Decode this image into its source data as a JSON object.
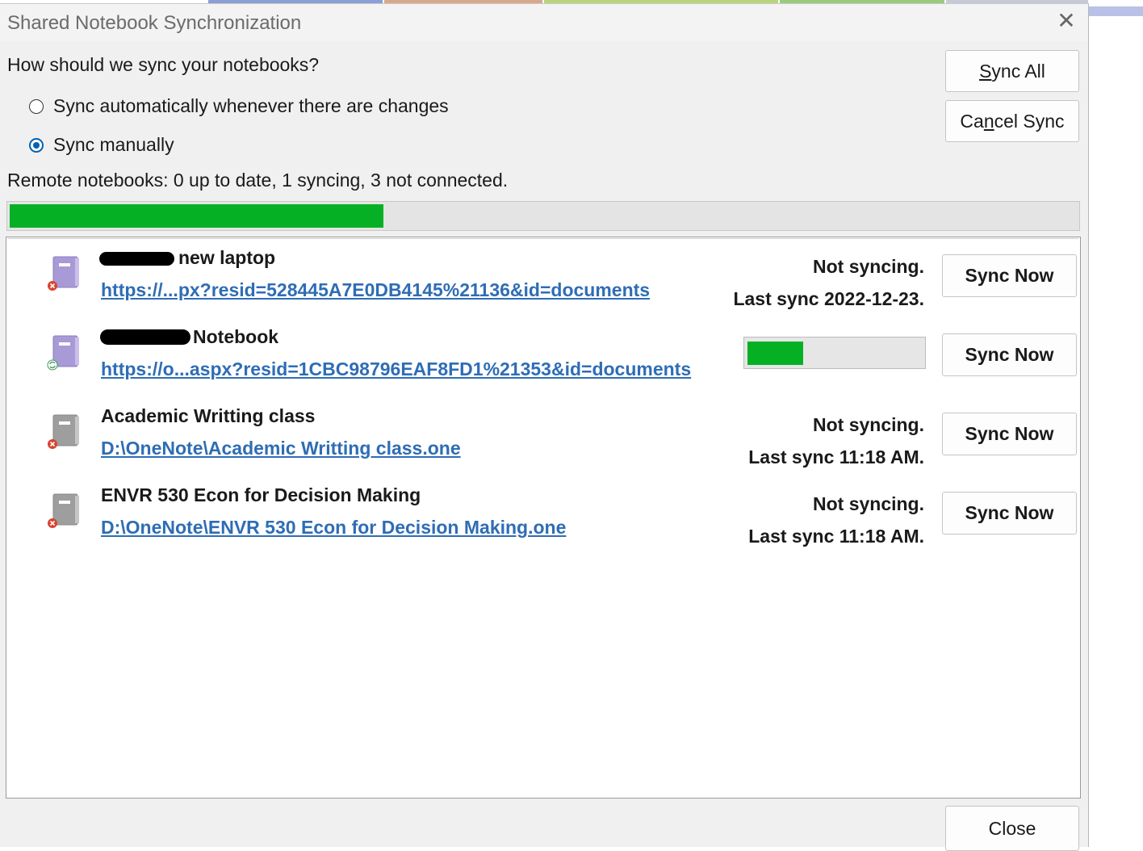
{
  "dialog": {
    "title": "Shared Notebook Synchronization",
    "close_glyph": "✕",
    "question": "How should we sync your notebooks?",
    "options": [
      {
        "label": "Sync automatically whenever there are changes",
        "checked": false
      },
      {
        "label": "Sync manually",
        "checked": true
      }
    ],
    "status_text": "Remote notebooks: 0 up to date, 1 syncing, 3 not connected.",
    "overall_progress": 0.35,
    "buttons": {
      "sync_all": {
        "prefix": "",
        "underlined": "S",
        "rest": "ync All"
      },
      "cancel_sync": {
        "prefix": "Ca",
        "underlined": "n",
        "rest": "cel Sync"
      },
      "close": "Close"
    },
    "accent_color": "#0062b1",
    "progress_color": "#06b025",
    "link_color": "#2e6db5"
  },
  "notebooks": [
    {
      "name": "new laptop",
      "link": "https://...px?resid=528445A7E0DB4145%21136&id=documents",
      "status_line1": "Not syncing.",
      "status_line2": "Last sync 2022-12-23.",
      "icon": "notebook-error-icon",
      "color": "#a79ad6",
      "button": "Sync Now"
    },
    {
      "name": "Notebook",
      "link": "https://o...aspx?resid=1CBC98796EAF8FD1%21353&id=documents",
      "progress": 0.32,
      "icon": "notebook-syncing-icon",
      "color": "#a79ad6",
      "button": "Sync Now"
    },
    {
      "name": "Academic Writting class",
      "link": "D:\\OneNote\\Academic Writting class.one",
      "status_line1": "Not syncing.",
      "status_line2": "Last sync 11:18 AM.",
      "icon": "notebook-error-icon",
      "color": "#9e9e9e",
      "button": "Sync Now"
    },
    {
      "name": "ENVR 530 Econ for Decision Making",
      "link": "D:\\OneNote\\ENVR 530 Econ for Decision Making.one",
      "status_line1": "Not syncing.",
      "status_line2": "Last sync 11:18 AM.",
      "icon": "notebook-error-icon",
      "color": "#9e9e9e",
      "button": "Sync Now"
    }
  ]
}
